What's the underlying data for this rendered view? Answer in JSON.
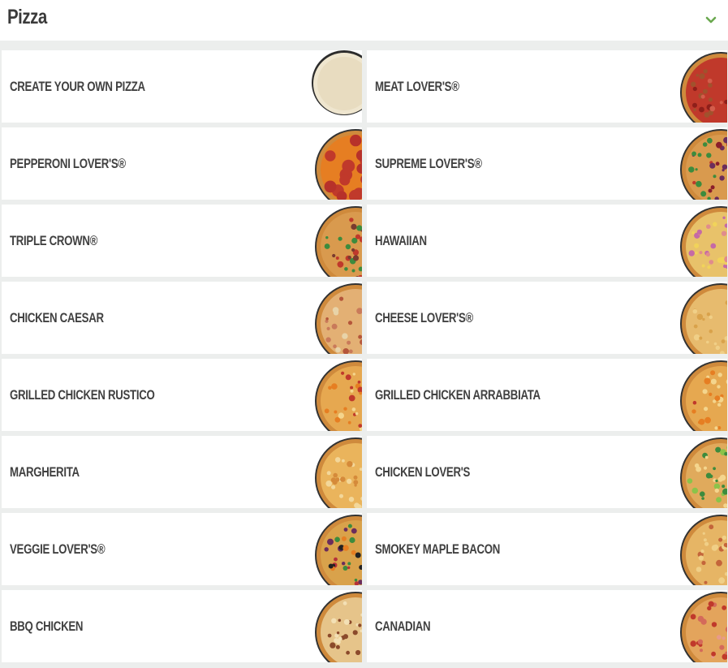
{
  "section": {
    "title": "Pizza",
    "toggle_icon": "chevron-down-icon",
    "accent_color": "#6aa84f"
  },
  "items": [
    {
      "label": "CREATE YOUR OWN PIZZA",
      "image": "dough-image",
      "toppings": "dough"
    },
    {
      "label": "MEAT LOVER'S®",
      "image": "pizza-image",
      "toppings": "meat"
    },
    {
      "label": "PEPPERONI LOVER'S®",
      "image": "pizza-image",
      "toppings": "pepperoni"
    },
    {
      "label": "SUPREME LOVER'S®",
      "image": "pizza-image",
      "toppings": "supreme"
    },
    {
      "label": "TRIPLE CROWN®",
      "image": "pizza-image",
      "toppings": "triple"
    },
    {
      "label": "HAWAIIAN",
      "image": "pizza-image",
      "toppings": "hawaiian"
    },
    {
      "label": "CHICKEN CAESAR",
      "image": "pizza-image",
      "toppings": "caesar"
    },
    {
      "label": "CHEESE LOVER'S®",
      "image": "pizza-image",
      "toppings": "cheese"
    },
    {
      "label": "GRILLED CHICKEN RUSTICO",
      "image": "pizza-image",
      "toppings": "rustico"
    },
    {
      "label": "GRILLED CHICKEN ARRABBIATA",
      "image": "pizza-image",
      "toppings": "arrabbiata"
    },
    {
      "label": "MARGHERITA",
      "image": "pizza-image",
      "toppings": "margherita"
    },
    {
      "label": "CHICKEN LOVER'S",
      "image": "pizza-image",
      "toppings": "chicken"
    },
    {
      "label": "VEGGIE LOVER'S®",
      "image": "pizza-image",
      "toppings": "veggie"
    },
    {
      "label": "SMOKEY MAPLE BACON",
      "image": "pizza-image",
      "toppings": "bacon"
    },
    {
      "label": "BBQ CHICKEN",
      "image": "pizza-image",
      "toppings": "bbq"
    },
    {
      "label": "CANADIAN",
      "image": "pizza-image",
      "toppings": "canadian"
    }
  ]
}
